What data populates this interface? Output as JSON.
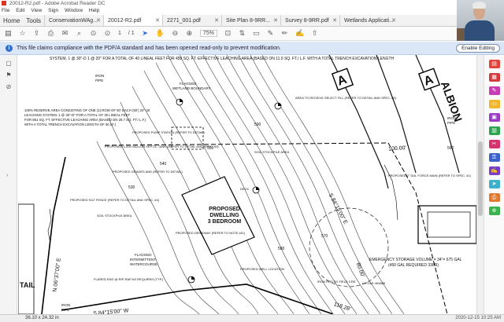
{
  "window": {
    "title": "20012-R2.pdf - Adobe Acrobat Reader DC"
  },
  "menu": [
    "File",
    "Edit",
    "View",
    "Sign",
    "Window",
    "Help"
  ],
  "nav": {
    "home": "Home",
    "tools": "Tools"
  },
  "tabs": [
    {
      "label": "ConservationWAg...",
      "active": false
    },
    {
      "label": "20012-R2.pdf",
      "active": true
    },
    {
      "label": "2271_001.pdf",
      "active": false
    },
    {
      "label": "Site Plan 8-9RR...",
      "active": false
    },
    {
      "label": "Survey 8-9RR.pdf",
      "active": false
    },
    {
      "label": "Wetlands Applicati...",
      "active": false
    }
  ],
  "toolbar": {
    "page_current": "1",
    "page_total": "/ 1",
    "zoom": "75%"
  },
  "infobar": {
    "message": "This file claims compliance with the PDF/A standard and has been opened read-only to prevent modification.",
    "enable_button": "Enable Editing"
  },
  "drawing": {
    "top_note": "SYSTEM, 1 @ 30\"-D  1 @ 20\" FOR A TOTAL OF 40 LINEAL FEET FOR 450 SQ. FT. EFFECTIVE LEACHING AREA (BASED ON 11.0 SQ. FT./ L.F. WITH A TOTAL TRENCH EXCAVATION LENGTH",
    "reserve_note": [
      "100% RESERVE AREA CONSISTING OF ONE (1) ROW OF 50' EACH (50') 24\"-30",
      "LEACHING SYSTEM, 1 @ 30\"-D\" FOR A TOTAL OF 30 LINEAL FEET",
      "FOR 861 SQ. FT. EFFECTIVE LEACHING AREA (BASED ON 28.7 SQ. FT./ L.F.)",
      "WITH A TOTAL TRENCH EXCAVATION LENGTH OF 30 LF.)"
    ],
    "dwelling": [
      "PROPOSED",
      "DWELLING",
      "3 BEDROOM"
    ],
    "road_name": "ALBION",
    "road_letter": "A",
    "flagged_wetland": [
      "FLAGGED",
      "WETLAND BOUNDARY"
    ],
    "flagged_watercourse": [
      "FLAGGED",
      "INTERMITTENT",
      "WATERCOURSE"
    ],
    "iron_pipe": [
      "IRON",
      "PIPE"
    ],
    "bearing_1": "N 06°37'00\" E",
    "bearing_2": "S 84°15'00\" W",
    "bearing_3": "S 84°15'00\" E",
    "dist_100": "100.00'",
    "dist_80": "80.00'",
    "dist_118": "118.28'",
    "emergency_note": [
      "EMERGENCY STORAGE VOLUME = 34\"= 675 GAL",
      "(450 GAL REQUIRED 338R)"
    ],
    "tail": "TAIL",
    "labels": [
      "PROPOSED PUMP STATION (REFER TO DETAIL)",
      "PROPOSED 1,000 GALLON SEPTIC TANK (REFER TO DETAIL AND SPEC. #3)",
      "PROPOSED GRADES AND (REFER TO DETAIL)",
      "PROPOSED SILT FENCE (REFER TO DETAIL AND SPEC. #4)",
      "SOIL STOCKPILE AREA",
      "PROPOSED DRIVEWAY (REFER TO NOTE #11)",
      "FLARED END @ RIP-RAP AS REQUIRED (TYP.)",
      "AREA TO RECEIVE SELECT FILL (REFER TO DETAIL AND SPEC. #5)",
      "PROPOSED 2\" DIA. FORCE MAIN (REFER TO SPEC. #1)",
      "PROPOSED WELL LOCATION",
      "IRON ROD BY FIELD CRE.",
      "U.POLE 4#4885",
      "DECK",
      "SOIL STOCKPILE AREA"
    ],
    "contours": [
      "560",
      "570",
      "580",
      "590",
      "550",
      "540",
      "530"
    ]
  },
  "status": {
    "page_size": "36.10 x 24.32 in",
    "tray": "2020-12-15  10:25 AM"
  },
  "icons": {
    "save": "save-icon",
    "star": "bookmark-star-icon",
    "print": "print-icon",
    "mail": "mail-icon",
    "search": "search-icon",
    "hand": "hand-tool-icon",
    "zoom_out": "zoom-out-icon",
    "zoom_in": "zoom-in-icon",
    "select": "select-cursor-icon",
    "pen": "pen-icon",
    "highlight": "highlight-icon",
    "sign": "sign-icon",
    "share": "share-icon",
    "info": "info-icon"
  },
  "right_tools": [
    {
      "name": "export-pdf-tool-icon",
      "color": "#e0443b"
    },
    {
      "name": "create-pdf-tool-icon",
      "color": "#d13c3c"
    },
    {
      "name": "edit-pdf-tool-icon",
      "color": "#c93cb4"
    },
    {
      "name": "comment-tool-icon",
      "color": "#f0b62e"
    },
    {
      "name": "combine-tool-icon",
      "color": "#9b3cc9"
    },
    {
      "name": "organize-tool-icon",
      "color": "#2ea44f"
    },
    {
      "name": "redact-tool-icon",
      "color": "#d4336e"
    },
    {
      "name": "protect-tool-icon",
      "color": "#3c63c9"
    },
    {
      "name": "fill-sign-tool-icon",
      "color": "#7b3cc9"
    },
    {
      "name": "send-tool-icon",
      "color": "#3cb1c9"
    },
    {
      "name": "scan-tool-icon",
      "color": "#e07a2e"
    },
    {
      "name": "more-tools-icon",
      "color": "#3cb14f"
    }
  ]
}
